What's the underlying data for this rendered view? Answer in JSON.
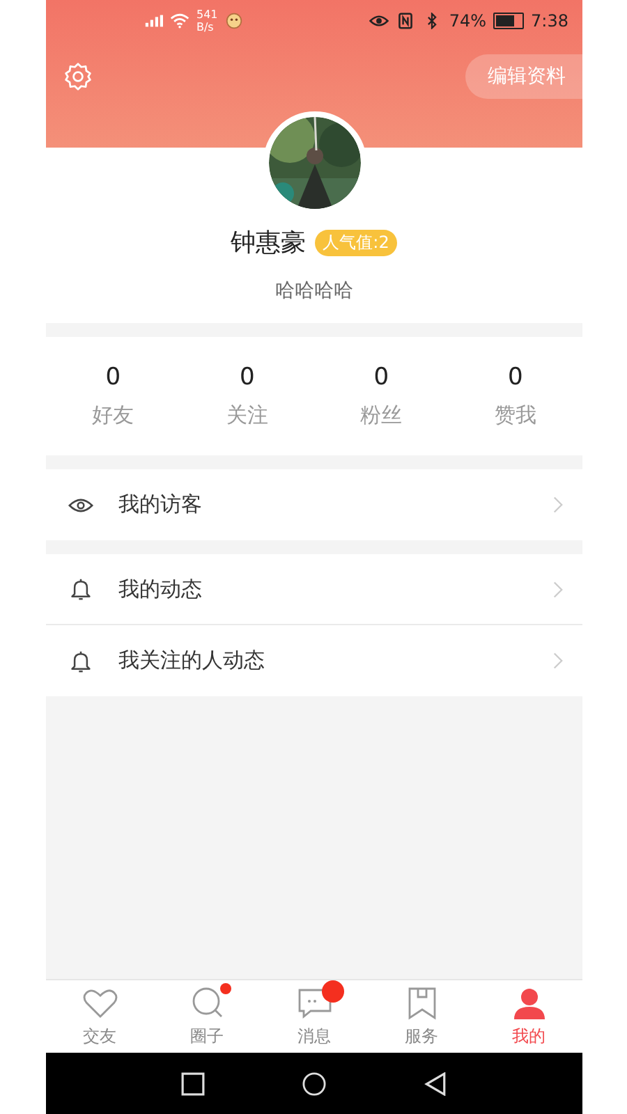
{
  "status_bar": {
    "speed_value": "541",
    "speed_unit": "B/s",
    "battery": "74%",
    "time": "7:38"
  },
  "header": {
    "edit_button": "编辑资料"
  },
  "profile": {
    "name": "钟惠豪",
    "badge": "人气值:2",
    "bio": "哈哈哈哈"
  },
  "stats": [
    {
      "value": "0",
      "label": "好友"
    },
    {
      "value": "0",
      "label": "关注"
    },
    {
      "value": "0",
      "label": "粉丝"
    },
    {
      "value": "0",
      "label": "赞我"
    }
  ],
  "menu_groups": [
    [
      {
        "label": "我的访客"
      }
    ],
    [
      {
        "label": "我的动态"
      },
      {
        "label": "我关注的人动态"
      }
    ]
  ],
  "tabs": [
    {
      "kind": "plain",
      "label": "交友",
      "selected": false
    },
    {
      "kind": "dot",
      "label": "圈子",
      "selected": false
    },
    {
      "kind": "bubble",
      "label": "消息",
      "selected": false
    },
    {
      "kind": "plain",
      "label": "服务",
      "selected": false
    },
    {
      "kind": "plain",
      "label": "我的",
      "selected": true
    }
  ]
}
